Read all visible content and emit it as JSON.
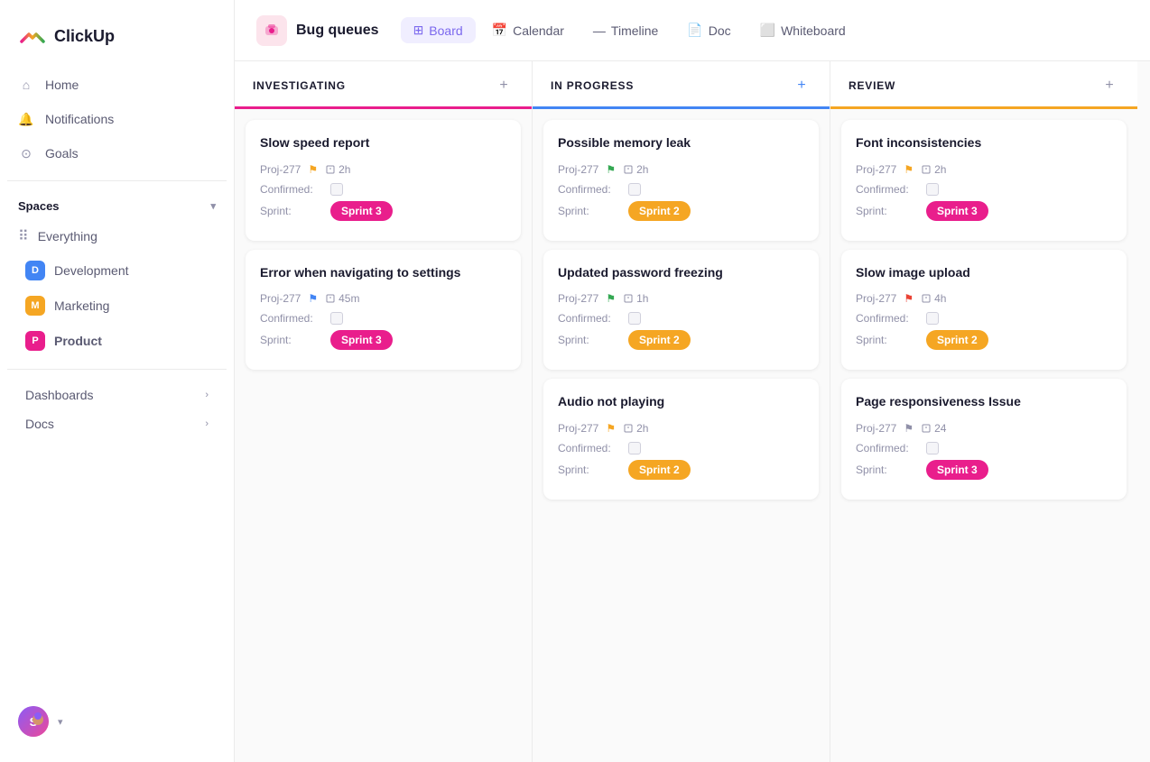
{
  "app": {
    "name": "ClickUp"
  },
  "sidebar": {
    "nav": [
      {
        "id": "home",
        "label": "Home",
        "icon": "🏠"
      },
      {
        "id": "notifications",
        "label": "Notifications",
        "icon": "🔔"
      },
      {
        "id": "goals",
        "label": "Goals",
        "icon": "🎯"
      }
    ],
    "spaces_label": "Spaces",
    "spaces": [
      {
        "id": "everything",
        "label": "Everything",
        "type": "everything"
      },
      {
        "id": "development",
        "label": "Development",
        "color": "#4285f4",
        "letter": "D"
      },
      {
        "id": "marketing",
        "label": "Marketing",
        "color": "#f5a623",
        "letter": "M"
      },
      {
        "id": "product",
        "label": "Product",
        "color": "#e91e8c",
        "letter": "P",
        "bold": true
      }
    ],
    "expandable": [
      {
        "id": "dashboards",
        "label": "Dashboards"
      },
      {
        "id": "docs",
        "label": "Docs"
      }
    ],
    "user_initial": "S"
  },
  "topbar": {
    "title": "Bug queues",
    "tabs": [
      {
        "id": "board",
        "label": "Board",
        "icon": "⊞",
        "active": true
      },
      {
        "id": "calendar",
        "label": "Calendar",
        "icon": "📅",
        "active": false
      },
      {
        "id": "timeline",
        "label": "Timeline",
        "icon": "—",
        "active": false
      },
      {
        "id": "doc",
        "label": "Doc",
        "icon": "📄",
        "active": false
      },
      {
        "id": "whiteboard",
        "label": "Whiteboard",
        "icon": "⬜",
        "active": false
      }
    ]
  },
  "columns": [
    {
      "id": "investigating",
      "title": "INVESTIGATING",
      "style": "investigating",
      "add_icon": "+",
      "cards": [
        {
          "id": "c1",
          "title": "Slow speed report",
          "proj": "Proj-277",
          "flag": "orange",
          "time": "2h",
          "confirmed": false,
          "sprint_label": "Sprint 3",
          "sprint_style": "pink"
        },
        {
          "id": "c2",
          "title": "Error when navigating to settings",
          "proj": "Proj-277",
          "flag": "blue",
          "time": "45m",
          "confirmed": false,
          "sprint_label": "Sprint 3",
          "sprint_style": "pink"
        }
      ]
    },
    {
      "id": "in-progress",
      "title": "IN PROGRESS",
      "style": "in-progress",
      "add_icon": "+",
      "add_blue": true,
      "cards": [
        {
          "id": "c3",
          "title": "Possible memory leak",
          "proj": "Proj-277",
          "flag": "green",
          "time": "2h",
          "confirmed": false,
          "sprint_label": "Sprint 2",
          "sprint_style": "orange"
        },
        {
          "id": "c4",
          "title": "Updated password freezing",
          "proj": "Proj-277",
          "flag": "green",
          "time": "1h",
          "confirmed": false,
          "sprint_label": "Sprint 2",
          "sprint_style": "orange"
        },
        {
          "id": "c5",
          "title": "Audio not playing",
          "proj": "Proj-277",
          "flag": "orange",
          "time": "2h",
          "confirmed": false,
          "sprint_label": "Sprint 2",
          "sprint_style": "orange"
        }
      ]
    },
    {
      "id": "review",
      "title": "REVIEW",
      "style": "review",
      "add_icon": "+",
      "cards": [
        {
          "id": "c6",
          "title": "Font inconsistencies",
          "proj": "Proj-277",
          "flag": "orange",
          "time": "2h",
          "confirmed": false,
          "sprint_label": "Sprint 3",
          "sprint_style": "pink"
        },
        {
          "id": "c7",
          "title": "Slow image upload",
          "proj": "Proj-277",
          "flag": "red",
          "time": "4h",
          "confirmed": false,
          "sprint_label": "Sprint 2",
          "sprint_style": "orange"
        },
        {
          "id": "c8",
          "title": "Page responsiveness Issue",
          "proj": "Proj-277",
          "flag": "gray",
          "time": "24",
          "confirmed": false,
          "sprint_label": "Sprint 3",
          "sprint_style": "pink"
        }
      ]
    }
  ]
}
